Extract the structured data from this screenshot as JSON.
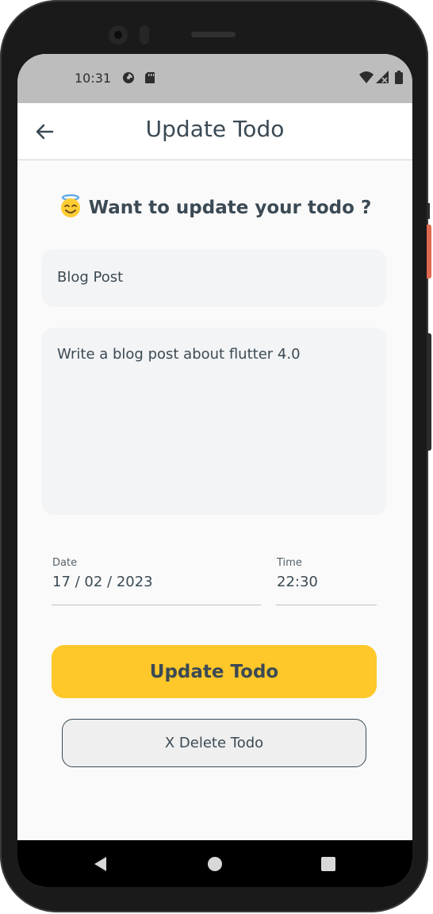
{
  "status_bar": {
    "time": "10:31"
  },
  "app_bar": {
    "title": "Update Todo",
    "back_icon": "arrow-left-icon"
  },
  "form": {
    "heading": "Want to update your todo ?",
    "heading_emoji": "smiling-face-with-halo",
    "title_value": "Blog Post",
    "description_value": "Write a blog post about flutter 4.0",
    "date_label": "Date",
    "date_value": "17 / 02 / 2023",
    "time_label": "Time",
    "time_value": "22:30"
  },
  "actions": {
    "update_label": "Update Todo",
    "delete_label": "X Delete Todo"
  },
  "colors": {
    "accent": "#fec72a",
    "text": "#3b4a54",
    "field_bg": "#f3f4f6",
    "status_bar_bg": "#bdbdbd"
  },
  "nav_bar": {
    "icons": [
      "back-triangle-icon",
      "home-circle-icon",
      "recents-square-icon"
    ]
  }
}
